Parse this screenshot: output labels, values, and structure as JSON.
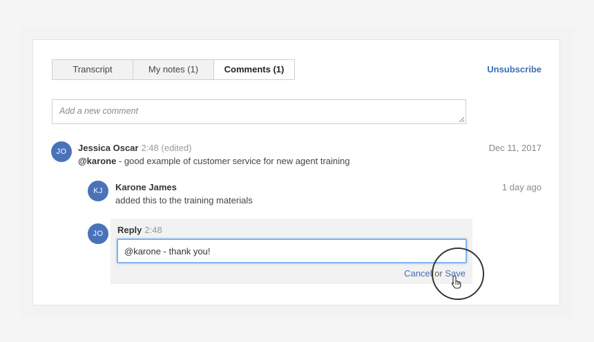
{
  "tabs": [
    {
      "label": "Transcript"
    },
    {
      "label": "My notes (1)"
    },
    {
      "label": "Comments (1)"
    }
  ],
  "header": {
    "unsubscribe_label": "Unsubscribe"
  },
  "new_comment": {
    "placeholder": "Add a new comment"
  },
  "comments": [
    {
      "initials": "JO",
      "author": "Jessica Oscar",
      "meta": "2:48 (edited)",
      "mention": "@karone",
      "body": " - good example of customer service for new agent training",
      "date": "Dec 11, 2017"
    },
    {
      "initials": "KJ",
      "author": "Karone James",
      "body": "added this to the training materials",
      "date": "1 day ago"
    }
  ],
  "reply": {
    "initials": "JO",
    "label": "Reply",
    "time": "2:48",
    "value": "@karone - thank you!",
    "cancel_label": "Cancel",
    "or_label": "or",
    "save_label": "Save"
  },
  "colors": {
    "accent": "#3e6db5",
    "avatar": "#4a72b8",
    "focus": "#7fb4ec"
  }
}
